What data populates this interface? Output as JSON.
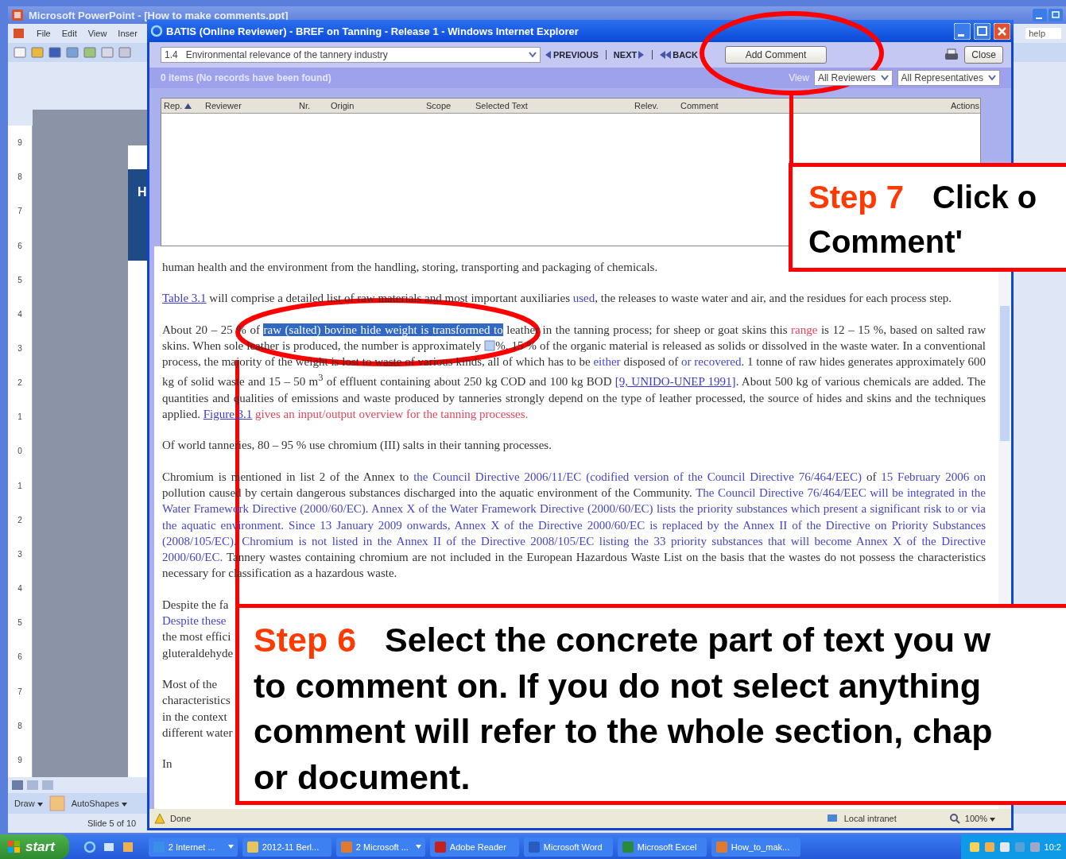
{
  "powerpoint": {
    "title": "Microsoft PowerPoint - [How to make comments.ppt]",
    "menu": [
      "File",
      "Edit",
      "View",
      "Inser"
    ],
    "help_field": "help",
    "ruler_labels": [
      "9",
      "8",
      "7",
      "6",
      "5",
      "4",
      "3",
      "2",
      "1",
      "0",
      "1",
      "2",
      "3",
      "4",
      "5",
      "6",
      "7",
      "8",
      "9"
    ],
    "slide_heading": "H",
    "draw_menu": "Draw",
    "autoshapes_menu": "AutoShapes",
    "status": "Slide 5 of 10"
  },
  "browser": {
    "title": "BATIS (Online Reviewer) - BREF on Tanning - Release 1 - Windows Internet Explorer",
    "section_select": "1.4   Environmental relevance of the tannery industry",
    "nav": [
      {
        "kind": "prev",
        "label": "PREVIOUS"
      },
      {
        "kind": "next",
        "label": "NEXT"
      },
      {
        "kind": "back",
        "label": "BACK"
      }
    ],
    "add_comment": "Add Comment",
    "close": "Close",
    "items_info": "0 items (No records have been found)",
    "view_label": "View",
    "filters": [
      "All Reviewers",
      "All Representatives"
    ],
    "columns": [
      {
        "label": "Rep.",
        "sorted": true
      },
      {
        "label": "Reviewer",
        "sorted": false
      },
      {
        "label": "Nr.",
        "sorted": false
      },
      {
        "label": "Origin",
        "sorted": false
      },
      {
        "label": "Scope",
        "sorted": false
      },
      {
        "label": "Selected Text",
        "sorted": false
      },
      {
        "label": "Relev.",
        "sorted": false
      },
      {
        "label": "Comment",
        "sorted": false
      },
      {
        "label": "Actions",
        "sorted": false
      }
    ],
    "document": [
      {
        "kind": "text",
        "segments": [
          {
            "kind": "plain",
            "text": "human health and the environment from the handling, storing, transporting and packaging of chemicals."
          }
        ]
      },
      {
        "kind": "text",
        "segments": [
          {
            "kind": "link",
            "text": "Table 3.1"
          },
          {
            "kind": "plain",
            "text": " will comprise a detailed list of raw materials and most important auxiliaries "
          },
          {
            "kind": "added",
            "text": "used"
          },
          {
            "kind": "plain",
            "text": ", the releases to waste water and air, and the residues for each process step."
          }
        ]
      },
      {
        "kind": "text",
        "segments": [
          {
            "kind": "plain",
            "text": "About 20 – 25 % of "
          },
          {
            "kind": "selected",
            "text": "raw (salted) bovine hide weight is transformed to"
          },
          {
            "kind": "plain",
            "text": " leather in the tanning process; for sheep or goat skins this "
          },
          {
            "kind": "deleted",
            "text": "range"
          },
          {
            "kind": "plain",
            "text": " is 12 – 15 %, based on salted raw skins. When sole leather is produced, the number is approximately "
          },
          {
            "kind": "comment_icon"
          },
          {
            "kind": "plain",
            "text": "%. 15 % of the organic material is released as solids or dissolved in the waste water. In a conventional process, the majority of the weight is lost to waste of various kinds, all of which has to be "
          },
          {
            "kind": "added",
            "text": "either"
          },
          {
            "kind": "plain",
            "text": " disposed of "
          },
          {
            "kind": "added",
            "text": "or recovered"
          },
          {
            "kind": "plain",
            "text": ". 1 tonne of raw hides generates approximately 600 kg of solid waste and 15 – 50 m$^{3}$ of effluent containing about 250 kg COD and 100 kg BOD "
          },
          {
            "kind": "link",
            "text": "[9, UNIDO-UNEP 1991]"
          },
          {
            "kind": "plain",
            "text": ". About 500 kg of various chemicals are added. The quantities and qualities of emissions and waste produced by tanneries strongly depend on the type of leather processed, the source of hides and skins and the techniques applied. "
          },
          {
            "kind": "link",
            "text": "Figure 3.1"
          },
          {
            "kind": "deleted",
            "text": " gives an input/output overview for the tanning processes."
          }
        ]
      },
      {
        "kind": "text",
        "segments": [
          {
            "kind": "plain",
            "text": "Of world tanneries, 80 – 95 % use chromium (III) salts in their tanning processes."
          }
        ]
      },
      {
        "kind": "text",
        "segments": [
          {
            "kind": "plain",
            "text": "Chromium is mentioned in list 2 of the Annex to "
          },
          {
            "kind": "added",
            "text": "the Council Directive 2006/11/EC (codified version of the Council Directive 76/464/EEC)"
          },
          {
            "kind": "plain",
            "text": " of "
          },
          {
            "kind": "added",
            "text": "15 February 2006 on"
          },
          {
            "kind": "plain",
            "text": " pollution caused by certain dangerous substances discharged into the aquatic environment of the Community. "
          },
          {
            "kind": "added",
            "text": "The Council Directive 76/464/EEC will be integrated in the Water Framework Directive (2000/60/EC). Annex X of the Water Framework Directive (2000/60/EC) lists the priority substances which present a significant risk to or via the aquatic environment. Since 13 January 2009 onwards, Annex X of the Directive 2000/60/EC is replaced by the Annex II of the Directive on Priority Substances (2008/105/EC). Chromium is not listed in the Annex II of the Directive 2008/105/EC listing the 33 priority substances that will become Annex X of the Directive 2000/60/EC."
          },
          {
            "kind": "plain",
            "text": " Tannery wastes containing chromium are not included in the European Hazardous Waste List on the basis that the wastes do not possess the characteristics necessary for classification as a hazardous waste."
          }
        ]
      },
      {
        "kind": "clipped",
        "lines": [
          {
            "kind": "plain",
            "text": "Despite the fa"
          },
          {
            "kind": "added",
            "text": "Despite these"
          },
          {
            "kind": "plain",
            "text": "the most effici"
          },
          {
            "kind": "plain",
            "text": "gluteraldehyde"
          }
        ]
      },
      {
        "kind": "clipped",
        "lines": [
          {
            "kind": "plain",
            "text": "Most of the"
          },
          {
            "kind": "plain",
            "text": "characteristics"
          },
          {
            "kind": "plain",
            "text": "in the context"
          },
          {
            "kind": "plain",
            "text": "different water"
          }
        ]
      },
      {
        "kind": "clipped",
        "lines": [
          {
            "kind": "plain",
            "text": "In"
          }
        ]
      }
    ],
    "status": {
      "text": "Done",
      "zone": "Local intranet",
      "zoom": "100%"
    }
  },
  "taskbar": {
    "start": "start",
    "tasks": [
      {
        "kind": "browser",
        "label": "2 Internet ...",
        "group": true
      },
      {
        "kind": "folder",
        "label": "2012-11 Berl...",
        "group": false
      },
      {
        "kind": "slides",
        "label": "2 Microsoft ...",
        "group": true
      },
      {
        "kind": "reader",
        "label": "Adobe Reader",
        "group": false
      },
      {
        "kind": "word",
        "label": "Microsoft Word",
        "group": false
      },
      {
        "kind": "excel",
        "label": "Microsoft Excel",
        "group": false
      },
      {
        "kind": "slides",
        "label": "How_to_mak...",
        "group": false
      }
    ],
    "clock": "10:2"
  },
  "callouts": [
    {
      "kind": "top",
      "step": "Step 7",
      "lines": [
        "Click o",
        "Comment'"
      ]
    },
    {
      "kind": "bottom",
      "step": "Step 6",
      "lines": [
        "Select the concrete part of text you w",
        "to comment on. If you do not select anything",
        "comment will refer to the whole section, chap",
        "or document."
      ]
    }
  ]
}
